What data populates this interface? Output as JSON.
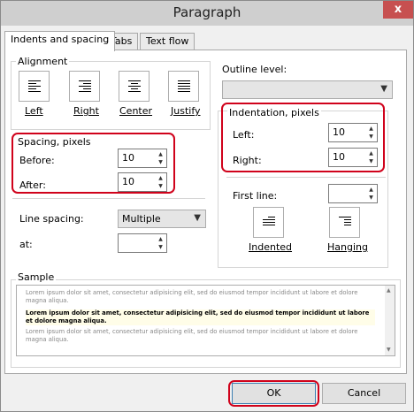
{
  "window": {
    "title": "Paragraph",
    "close_glyph": "x"
  },
  "tabs": [
    "Indents and spacing",
    "Tabs",
    "Text flow"
  ],
  "alignment": {
    "title": "Alignment",
    "options": [
      "Left",
      "Right",
      "Center",
      "Justify"
    ],
    "icons": [
      "align-left-icon",
      "align-right-icon",
      "align-center-icon",
      "align-justify-icon"
    ]
  },
  "outline": {
    "label": "Outline level:",
    "value": ""
  },
  "spacing": {
    "title": "Spacing, pixels",
    "before_label": "Before:",
    "before_value": "10",
    "after_label": "After:",
    "after_value": "10",
    "line_spacing_label": "Line spacing:",
    "line_spacing_value": "Multiple",
    "at_label": "at:",
    "at_value": ""
  },
  "indentation": {
    "title": "Indentation, pixels",
    "left_label": "Left:",
    "left_value": "10",
    "right_label": "Right:",
    "right_value": "10",
    "first_line_label": "First line:",
    "first_line_value": "",
    "indented_label": "Indented",
    "hanging_label": "Hanging"
  },
  "sample": {
    "title": "Sample",
    "before_text": "Lorem ipsum dolor sit amet, consectetur adipisicing elit, sed do eiusmod tempor incididunt ut labore et dolore magna aliqua.",
    "current_text": "Lorem ipsum dolor sit amet, consectetur adipisicing elit, sed do eiusmod tempor incididunt ut labore et dolore magna aliqua.",
    "after_text": "Lorem ipsum dolor sit amet, consectetur adipisicing elit, sed do eiusmod tempor incididunt ut labore et dolore magna aliqua."
  },
  "buttons": {
    "ok": "OK",
    "cancel": "Cancel"
  },
  "colors": {
    "highlight": "#d0021b",
    "title_bar": "#cfcfcf",
    "close_button": "#c75050"
  }
}
